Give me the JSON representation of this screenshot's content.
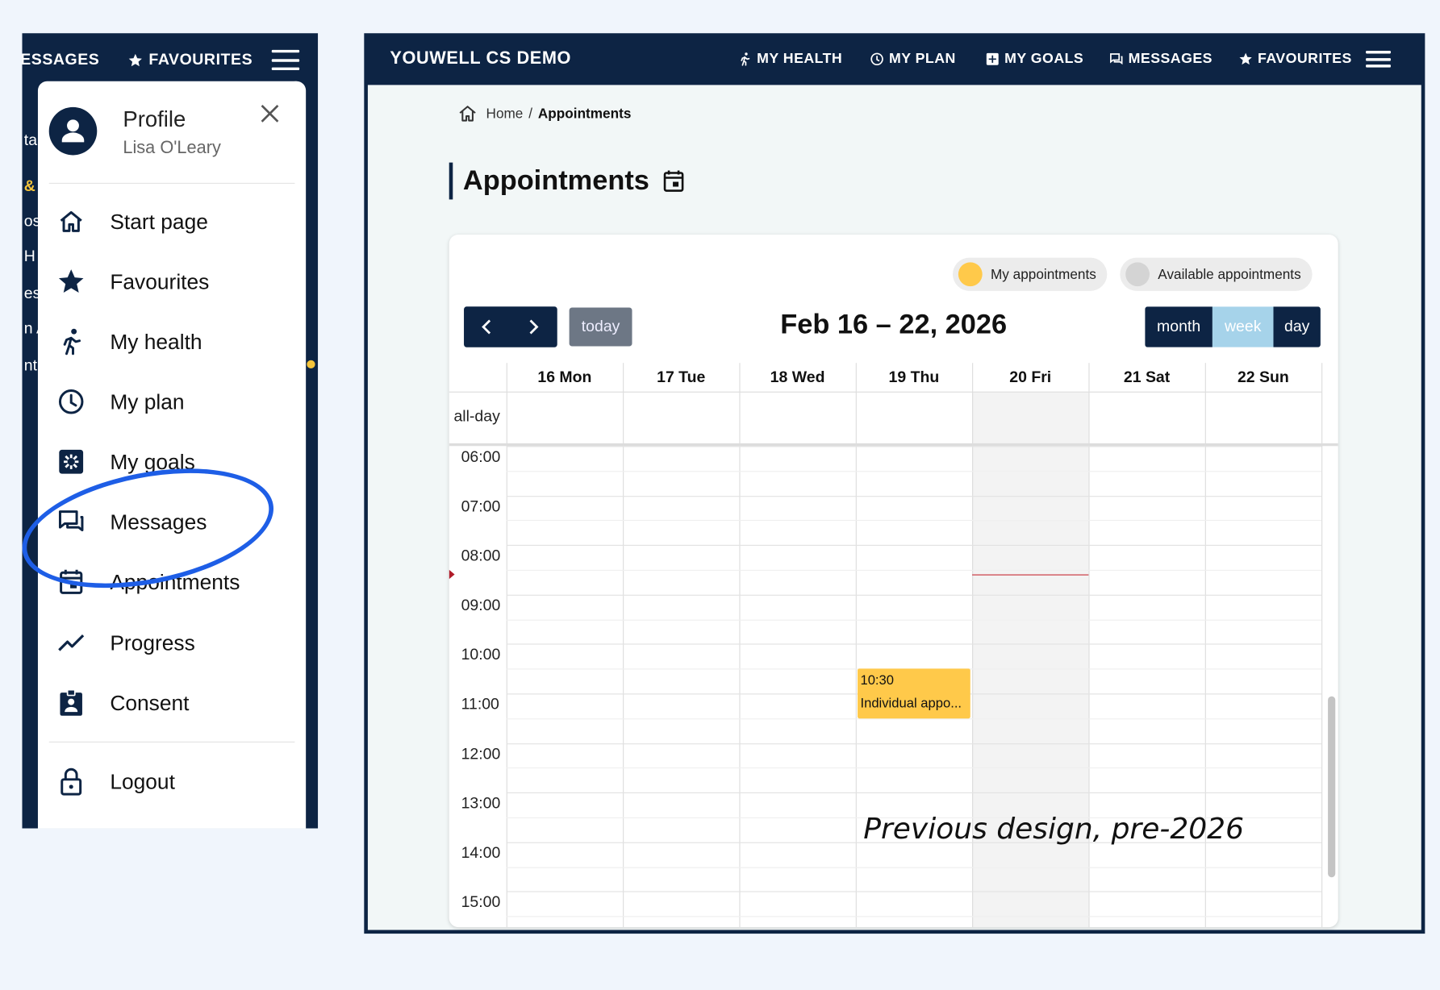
{
  "mobile": {
    "bar": {
      "messages_partial": "ESSAGES",
      "favourites": "FAVOURITES"
    },
    "side_partial": [
      "ta",
      "&",
      "os",
      "H",
      "es",
      "n A",
      "nt"
    ],
    "profile": {
      "title": "Profile",
      "name": "Lisa O'Leary"
    },
    "menu": [
      {
        "label": "Start page",
        "icon": "home-icon"
      },
      {
        "label": "Favourites",
        "icon": "star-icon"
      },
      {
        "label": "My health",
        "icon": "runner-icon"
      },
      {
        "label": "My plan",
        "icon": "clock-icon"
      },
      {
        "label": "My goals",
        "icon": "goals-icon"
      },
      {
        "label": "Messages",
        "icon": "messages-icon"
      },
      {
        "label": "Appointments",
        "icon": "calendar-icon"
      },
      {
        "label": "Progress",
        "icon": "trend-icon"
      },
      {
        "label": "Consent",
        "icon": "clipboard-icon"
      }
    ],
    "logout": "Logout",
    "highlight_color": "#1e5ee6"
  },
  "desktop": {
    "brand": "YOUWELL CS DEMO",
    "nav": [
      {
        "label": "MY HEALTH",
        "icon": "runner-icon"
      },
      {
        "label": "MY PLAN",
        "icon": "clock-icon"
      },
      {
        "label": "MY GOALS",
        "icon": "goals-icon"
      },
      {
        "label": "MESSAGES",
        "icon": "messages-icon"
      },
      {
        "label": "FAVOURITES",
        "icon": "star-icon"
      }
    ],
    "breadcrumb": {
      "home": "Home",
      "separator": "/",
      "current": "Appointments"
    },
    "page_title": "Appointments",
    "legend": [
      {
        "label": "My appointments",
        "color": "#ffc94a"
      },
      {
        "label": "Available appointments",
        "color": "#d4d4d4"
      }
    ],
    "calendar": {
      "today_label": "today",
      "range": "Feb 16 – 22, 2026",
      "views": [
        "month",
        "week",
        "day"
      ],
      "active_view": "week",
      "days": [
        "16 Mon",
        "17 Tue",
        "18 Wed",
        "19 Thu",
        "20 Fri",
        "21 Sat",
        "22 Sun"
      ],
      "today_index": 4,
      "all_day_label": "all-day",
      "hours": [
        "06:00",
        "07:00",
        "08:00",
        "09:00",
        "10:00",
        "11:00",
        "12:00",
        "13:00",
        "14:00",
        "15:00"
      ],
      "now_time": "08:36",
      "events": [
        {
          "day_index": 3,
          "start": "10:30",
          "end": "11:30",
          "time_label": "10:30",
          "title": "Individual appo..."
        }
      ]
    },
    "colors": {
      "navy": "#0d2444",
      "event": "#ffc94a",
      "active_view": "#a6d3ea"
    }
  },
  "caption": "Previous design, pre-2026"
}
